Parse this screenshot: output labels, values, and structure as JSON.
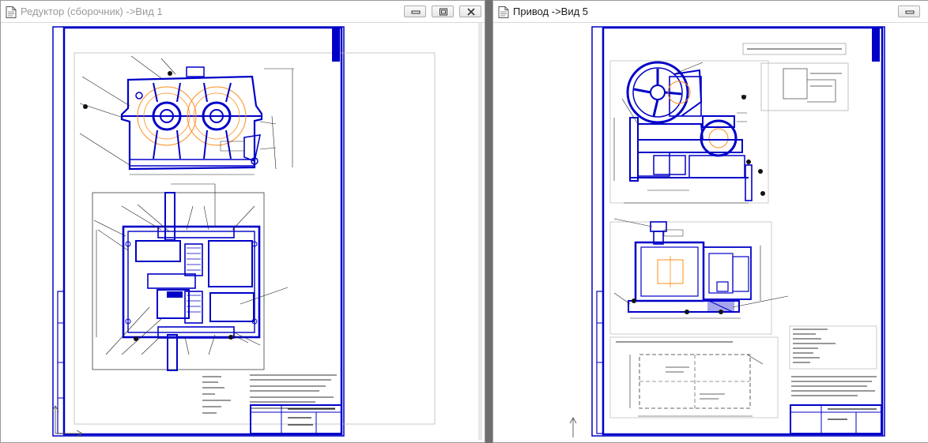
{
  "windows": [
    {
      "title": "Редуктор (сборочник) ->Вид 1",
      "active": false
    },
    {
      "title": "Привод ->Вид 5",
      "active": true
    }
  ],
  "colors": {
    "frame": "#0000c8",
    "accent": "#ff8c1a",
    "dim": "#1c1c1c",
    "titlebar_text_inactive": "#9a9a9a",
    "titlebar_text_active": "#1a1a1a"
  },
  "icons": [
    "document-icon",
    "minimize-icon",
    "maximize-icon",
    "close-icon",
    "coordinate-axes-icon"
  ]
}
